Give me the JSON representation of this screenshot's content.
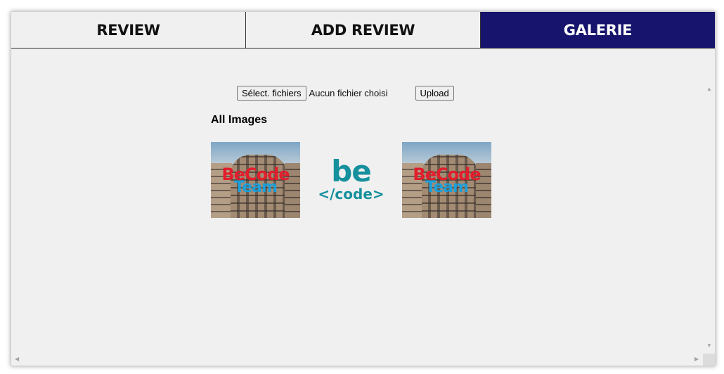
{
  "tabs": [
    {
      "label": "REVIEW",
      "active": false
    },
    {
      "label": "ADD REVIEW",
      "active": false
    },
    {
      "label": "GALERIE",
      "active": true
    }
  ],
  "upload": {
    "select_label": "Sélect. fichiers",
    "no_file_text": "Aucun fichier choisi",
    "upload_label": "Upload"
  },
  "gallery": {
    "heading": "All Images",
    "images": [
      {
        "kind": "photo",
        "text_line1": "BeCode",
        "text_line2": "Team"
      },
      {
        "kind": "logo",
        "text_line1": "be",
        "text_line2": "</code>"
      },
      {
        "kind": "photo",
        "text_line1": "BeCode",
        "text_line2": "Team"
      }
    ]
  },
  "colors": {
    "active_tab": "#16146c",
    "background": "#f0f0f0",
    "logo": "#15909c",
    "photo_text_red": "#e21d2c",
    "photo_text_blue": "#1aa0dc"
  }
}
